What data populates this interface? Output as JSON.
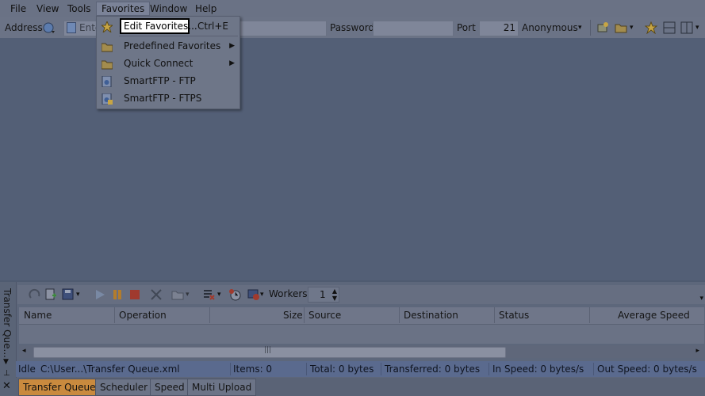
{
  "menubar": {
    "items": [
      "File",
      "View",
      "Tools",
      "Favorites",
      "Window",
      "Help"
    ]
  },
  "toolbar": {
    "address_label": "Address",
    "address_placeholder": "Ente",
    "password_label": "Password",
    "port_label": "Port",
    "port_value": "21",
    "anonymous_label": "Anonymous"
  },
  "favorites_menu": {
    "items": [
      {
        "label": "Edit Favorites...",
        "shortcut": "Ctrl+E",
        "icon": "star-icon"
      },
      {
        "label": "Predefined Favorites",
        "icon": "folder-icon",
        "submenu": true
      },
      {
        "label": "Quick Connect",
        "icon": "folder-icon",
        "submenu": true
      },
      {
        "label": "SmartFTP - FTP",
        "icon": "ftp-icon"
      },
      {
        "label": "SmartFTP - FTPS",
        "icon": "ftps-icon"
      }
    ]
  },
  "queue": {
    "side_tab_label": "Transfer Que...",
    "workers_label": "Workers",
    "workers_value": "1",
    "columns": [
      "Name",
      "Operation",
      "Size",
      "Source",
      "Destination",
      "Status",
      "Average Speed"
    ],
    "status": {
      "state": "Idle",
      "file": "C:\\User...\\Transfer Queue.xml",
      "items": "Items: 0",
      "total": "Total: 0 bytes",
      "transferred": "Transferred: 0 bytes",
      "in_speed": "In Speed: 0 bytes/s",
      "out_speed": "Out Speed: 0 bytes/s"
    },
    "tabs": [
      "Transfer Queue",
      "Scheduler",
      "Speed",
      "Multi Upload"
    ]
  },
  "colors": {
    "accent_tab": "#c98a3e",
    "workspace": "#535f76"
  }
}
